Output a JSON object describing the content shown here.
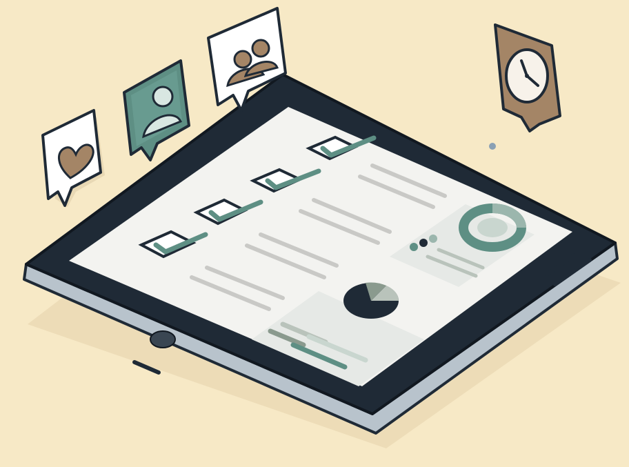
{
  "scene": {
    "background_color": "#f7e9c6",
    "subject": "tablet-with-checklist-and-charts"
  },
  "tablet": {
    "bezel_color": "#1f2a36",
    "edge_color": "#b8c3cc",
    "screen_color": "#f3f3f0",
    "checklist": {
      "items": [
        {
          "checked": true
        },
        {
          "checked": true
        },
        {
          "checked": true
        },
        {
          "checked": true
        }
      ],
      "check_color": "#5e8f84"
    },
    "cards": [
      {
        "kind": "pie-chart-with-bars",
        "colors": [
          "#1f2a36",
          "#8a9a8e",
          "#b9c3bb"
        ]
      },
      {
        "kind": "donut-chart-with-dots",
        "colors": [
          "#5e8f84",
          "#9bb6ad",
          "#c9d6cf"
        ]
      }
    ]
  },
  "floating_icons": [
    {
      "icon": "heart-icon",
      "color": "#a48566"
    },
    {
      "icon": "user-icon",
      "color": "#5e8f84"
    },
    {
      "icon": "people-icon",
      "color": "#a48566"
    },
    {
      "icon": "clock-icon",
      "color": "#a48566"
    }
  ]
}
